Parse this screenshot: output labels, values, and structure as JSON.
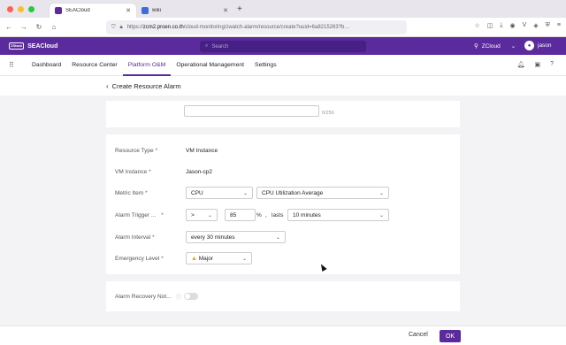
{
  "browser": {
    "tabs": [
      {
        "title": "SEACloud",
        "active": true,
        "favicon_color": "#5b2b9e"
      },
      {
        "title": "wiki",
        "active": false,
        "favicon_color": "#3b6fd8"
      }
    ],
    "url_prefix": "https://",
    "url_host": "zcm2.proen.co.th",
    "url_path": "/cloud-monitoring/zwatch-alarm/resource/create?uuid=6a8215263?b…"
  },
  "app": {
    "brand": "SEACloud",
    "brand_mark": "ZStack",
    "search_placeholder": "Search",
    "zone": "ZCloud",
    "user": "jason",
    "header_color": "#5b2b9e"
  },
  "nav": {
    "items": [
      {
        "label": "Dashboard"
      },
      {
        "label": "Resource Center"
      },
      {
        "label": "Platform O&M"
      },
      {
        "label": "Operational Management"
      },
      {
        "label": "Settings"
      }
    ],
    "active_index": 2
  },
  "page": {
    "title": "Create Resource Alarm",
    "counter": "0/256"
  },
  "form": {
    "resource_type": {
      "label": "Resource Type",
      "value": "VM Instance"
    },
    "vm_instance": {
      "label": "VM Instance",
      "value": "Jason-cp2"
    },
    "metric_item": {
      "label": "Metric Item",
      "value1": "CPU",
      "value2": "CPU Utilization Average"
    },
    "alarm_trigger": {
      "label": "Alarm Trigger ...",
      "operator": ">",
      "threshold": "85",
      "unit": "%",
      "comma": ",",
      "lasts_label": "lasts",
      "duration": "10 minutes"
    },
    "alarm_interval": {
      "label": "Alarm Interval",
      "value": "every 30 minutes"
    },
    "emergency_level": {
      "label": "Emergency Level",
      "value": "Major"
    },
    "recovery": {
      "label": "Alarm Recovery Not..."
    }
  },
  "footer": {
    "cancel": "Cancel",
    "ok": "OK"
  }
}
